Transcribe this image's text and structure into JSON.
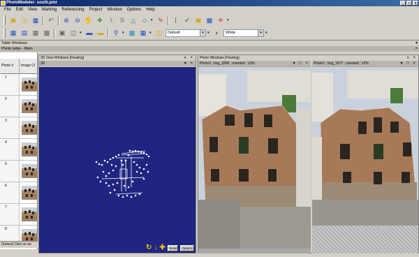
{
  "app": {
    "title": "PhotoModeler: south.pmr",
    "win_controls": [
      "_",
      "□",
      "×"
    ]
  },
  "menu": [
    "File",
    "Edit",
    "View",
    "Marking",
    "Referencing",
    "Project",
    "Window",
    "Options",
    "Help"
  ],
  "toolbar": {
    "quality_combo": "Default",
    "color_combo": "White"
  },
  "table_windows": {
    "label": "Table Windows",
    "photo_table_label": "Photo table - Main",
    "columns": [
      "Photo #",
      "Image Cl"
    ],
    "rows": [
      "1",
      "2",
      "3",
      "4",
      "5",
      "6",
      "7",
      "8"
    ]
  },
  "status": {
    "text": "[Select] Click on an"
  },
  "view3d": {
    "window_title": "3D View Windows [Floating]",
    "pane_title": "3D",
    "controls": [
      "» ×",
      "▾ ×"
    ],
    "reset_label": "Reset",
    "options_label": "Options"
  },
  "photo_window": {
    "window_title": "Photo Windows [Floating]",
    "controls": "» ×",
    "pane_a_title": "Photo3 : Img_1666 : oriented : 12%",
    "pane_b_title": "Photo1 : Img_1677 : oriented : 12%",
    "pane_controls": "▾ □ ×"
  },
  "colors": {
    "viewport_bg": "#1f2580",
    "titlebar": "#0a246a",
    "accent_icon": "#f0c000"
  }
}
